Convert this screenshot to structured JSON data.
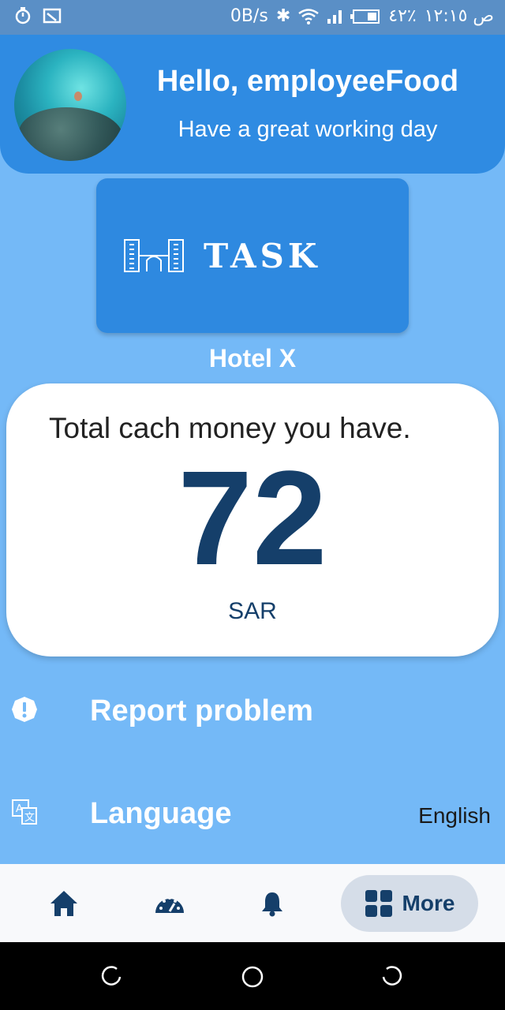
{
  "status_bar": {
    "net_speed": "0B/s",
    "battery": "٤٢٪",
    "time": "ص ١٢:١٥"
  },
  "header": {
    "greeting": "Hello, employeeFood",
    "subtitle": "Have a great working day"
  },
  "logo": {
    "text": "TASK"
  },
  "hotel": {
    "name": "Hotel X"
  },
  "money_card": {
    "label": "Total cach money you have.",
    "amount": "72",
    "currency": "SAR"
  },
  "menu": {
    "report": {
      "label": "Report problem",
      "icon": "alert-circle-icon"
    },
    "language": {
      "label": "Language",
      "value": "English",
      "icon": "translate-icon"
    }
  },
  "bottom_nav": {
    "items": [
      {
        "icon": "home-icon"
      },
      {
        "icon": "speedometer-icon"
      },
      {
        "icon": "bell-icon"
      },
      {
        "icon": "grid-icon",
        "label": "More",
        "active": true
      }
    ]
  },
  "colors": {
    "background": "#74b9f7",
    "header": "#2f8be2",
    "accent_dark": "#153f6a",
    "status_bar": "#5a8fc6"
  }
}
